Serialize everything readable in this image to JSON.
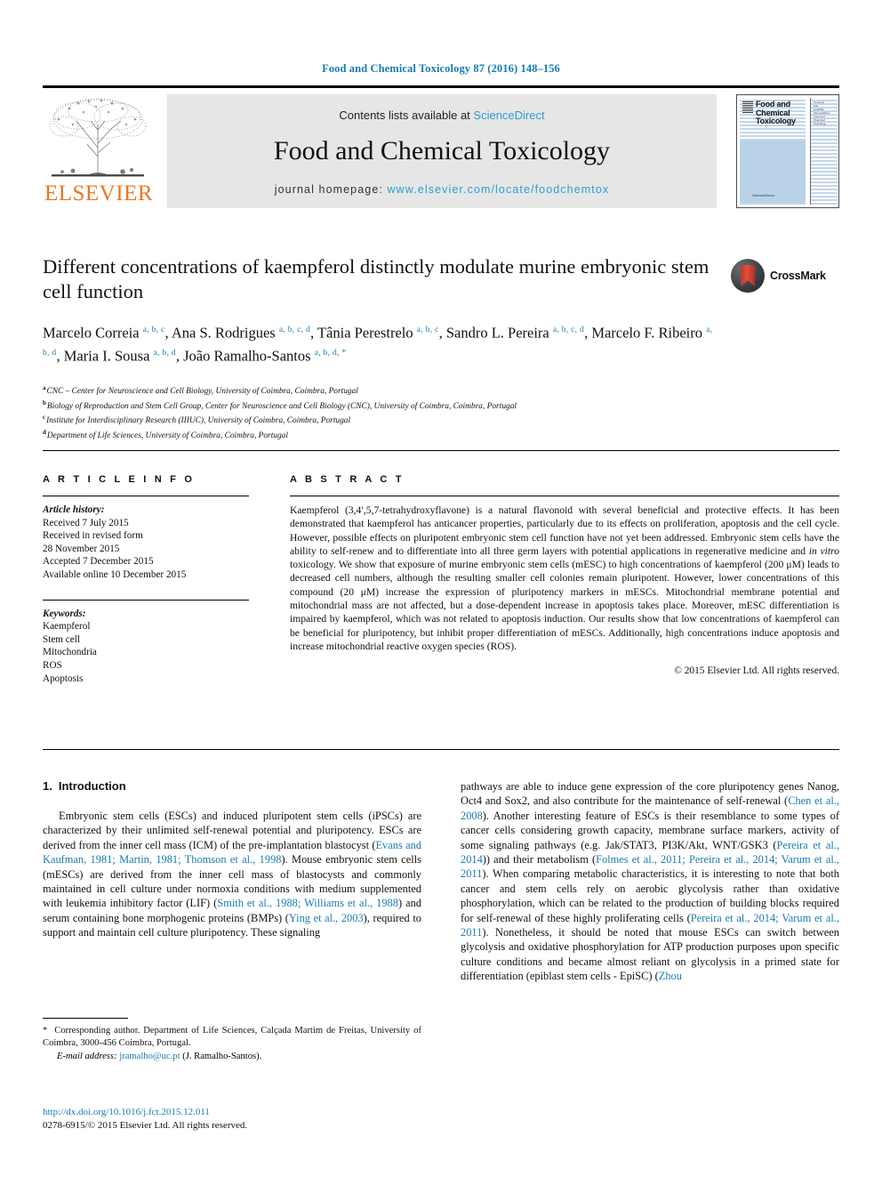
{
  "running_head": "Food and Chemical Toxicology 87 (2016) 148–156",
  "masthead": {
    "contents_prefix": "Contents lists available at ",
    "sciencedirect": "ScienceDirect",
    "journal_title": "Food and Chemical Toxicology",
    "homepage_prefix": "journal homepage: ",
    "homepage_url": "www.elsevier.com/locate/foodchemtox",
    "publisher_logo_text": "ELSEVIER",
    "cover_title": "Food and Chemical Toxicology",
    "cover_footer": "ScienceDirect",
    "link_color": "#2e9bd6",
    "header_color": "#1a7bb0"
  },
  "article": {
    "title": "Different concentrations of kaempferol distinctly modulate murine embryonic stem cell function",
    "crossmark_label": "CrossMark",
    "authors_html": "Marcelo Correia <sup>a, b, c</sup>, Ana S. Rodrigues <sup>a, b, c, d</sup>, Tânia Perestrelo <sup>a, b, c</sup>, Sandro L. Pereira <sup>a, b, c, d</sup>, Marcelo F. Ribeiro <sup>a, b, d</sup>, Maria I. Sousa <sup>a, b, d</sup>, João Ramalho-Santos <sup>a, b, d, *</sup>",
    "affiliations": [
      {
        "mark": "a",
        "text": "CNC – Center for Neuroscience and Cell Biology, University of Coimbra, Coimbra, Portugal"
      },
      {
        "mark": "b",
        "text": "Biology of Reproduction and Stem Cell Group, Center for Neuroscience and Cell Biology (CNC), University of Coimbra, Coimbra, Portugal"
      },
      {
        "mark": "c",
        "text": "Institute for Interdisciplinary Research (IIIUC), University of Coimbra, Coimbra, Portugal"
      },
      {
        "mark": "d",
        "text": "Department of Life Sciences, University of Coimbra, Coimbra, Portugal"
      }
    ]
  },
  "article_info": {
    "heading": "A R T I C L E   I N F O",
    "history_label": "Article history:",
    "history": [
      "Received 7 July 2015",
      "Received in revised form",
      "28 November 2015",
      "Accepted 7 December 2015",
      "Available online 10 December 2015"
    ],
    "keywords_label": "Keywords:",
    "keywords": [
      "Kaempferol",
      "Stem cell",
      "Mitochondria",
      "ROS",
      "Apoptosis"
    ]
  },
  "abstract": {
    "heading": "A B S T R A C T",
    "text_html": "Kaempferol (3,4′,5,7-tetrahydroxyflavone) is a natural flavonoid with several beneficial and protective effects. It has been demonstrated that kaempferol has anticancer properties, particularly due to its effects on proliferation, apoptosis and the cell cycle. However, possible effects on pluripotent embryonic stem cell function have not yet been addressed. Embryonic stem cells have the ability to self-renew and to differentiate into all three germ layers with potential applications in regenerative medicine and <span class=\"ital\">in vitro</span> toxicology. We show that exposure of murine embryonic stem cells (mESC) to high concentrations of kaempferol (200 μM) leads to decreased cell numbers, although the resulting smaller cell colonies remain pluripotent. However, lower concentrations of this compound (20 μM) increase the expression of pluripotency markers in mESCs. Mitochondrial membrane potential and mitochondrial mass are not affected, but a dose-dependent increase in apoptosis takes place. Moreover, mESC differentiation is impaired by kaempferol, which was not related to apoptosis induction. Our results show that low concentrations of kaempferol can be beneficial for pluripotency, but inhibit proper differentiation of mESCs. Additionally, high concentrations induce apoptosis and increase mitochondrial reactive oxygen species (ROS).",
    "copyright": "© 2015 Elsevier Ltd. All rights reserved."
  },
  "introduction": {
    "number": "1.",
    "heading": "Introduction",
    "left_html": "Embryonic stem cells (ESCs) and induced pluripotent stem cells (iPSCs) are characterized by their unlimited self-renewal potential and pluripotency. ESCs are derived from the inner cell mass (ICM) of the pre-implantation blastocyst (<span class=\"ref\">Evans and Kaufman, 1981; Martin, 1981; Thomson et al., 1998</span>). Mouse embryonic stem cells (mESCs) are derived from the inner cell mass of blastocysts and commonly maintained in cell culture under normoxia conditions with medium supplemented with leukemia inhibitory factor (LIF) (<span class=\"ref\">Smith et al., 1988; Williams et al., 1988</span>) and serum containing bone morphogenic proteins (BMPs) (<span class=\"ref\">Ying et al., 2003</span>), required to support and maintain cell culture pluripotency. These signaling",
    "right_html": "pathways are able to induce gene expression of the core pluripotency genes Nanog, Oct4 and Sox2, and also contribute for the maintenance of self-renewal (<span class=\"ref\">Chen et al., 2008</span>). Another interesting feature of ESCs is their resemblance to some types of cancer cells considering growth capacity, membrane surface markers, activity of some signaling pathways (e.g. Jak/STAT3, PI3K/Akt, WNT/GSK3 (<span class=\"ref\">Pereira et al., 2014</span>)) and their metabolism (<span class=\"ref\">Folmes et al., 2011; Pereira et al., 2014; Varum et al., 2011</span>). When comparing metabolic characteristics, it is interesting to note that both cancer and stem cells rely on aerobic glycolysis rather than oxidative phosphorylation, which can be related to the production of building blocks required for self-renewal of these highly proliferating cells (<span class=\"ref\">Pereira et al., 2014; Varum et al., 2011</span>). Nonetheless, it should be noted that mouse ESCs can switch between glycolysis and oxidative phosphorylation for ATP production purposes upon specific culture conditions and became almost reliant on glycolysis in a primed state for differentiation (epiblast stem cells - EpiSC) (<span class=\"ref\">Zhou</span>"
  },
  "footer": {
    "corresponding_html": "<span class=\"star\">*</span> Corresponding author. Department of Life Sciences, Calçada Martim de Freitas, University of Coimbra, 3000-456 Coimbra, Portugal.",
    "email_label": "E-mail address:",
    "email": "jramalho@uc.pt",
    "email_suffix": "(J. Ramalho-Santos).",
    "doi": "http://dx.doi.org/10.1016/j.fct.2015.12.011",
    "issn_line": "0278-6915/© 2015 Elsevier Ltd. All rights reserved."
  }
}
